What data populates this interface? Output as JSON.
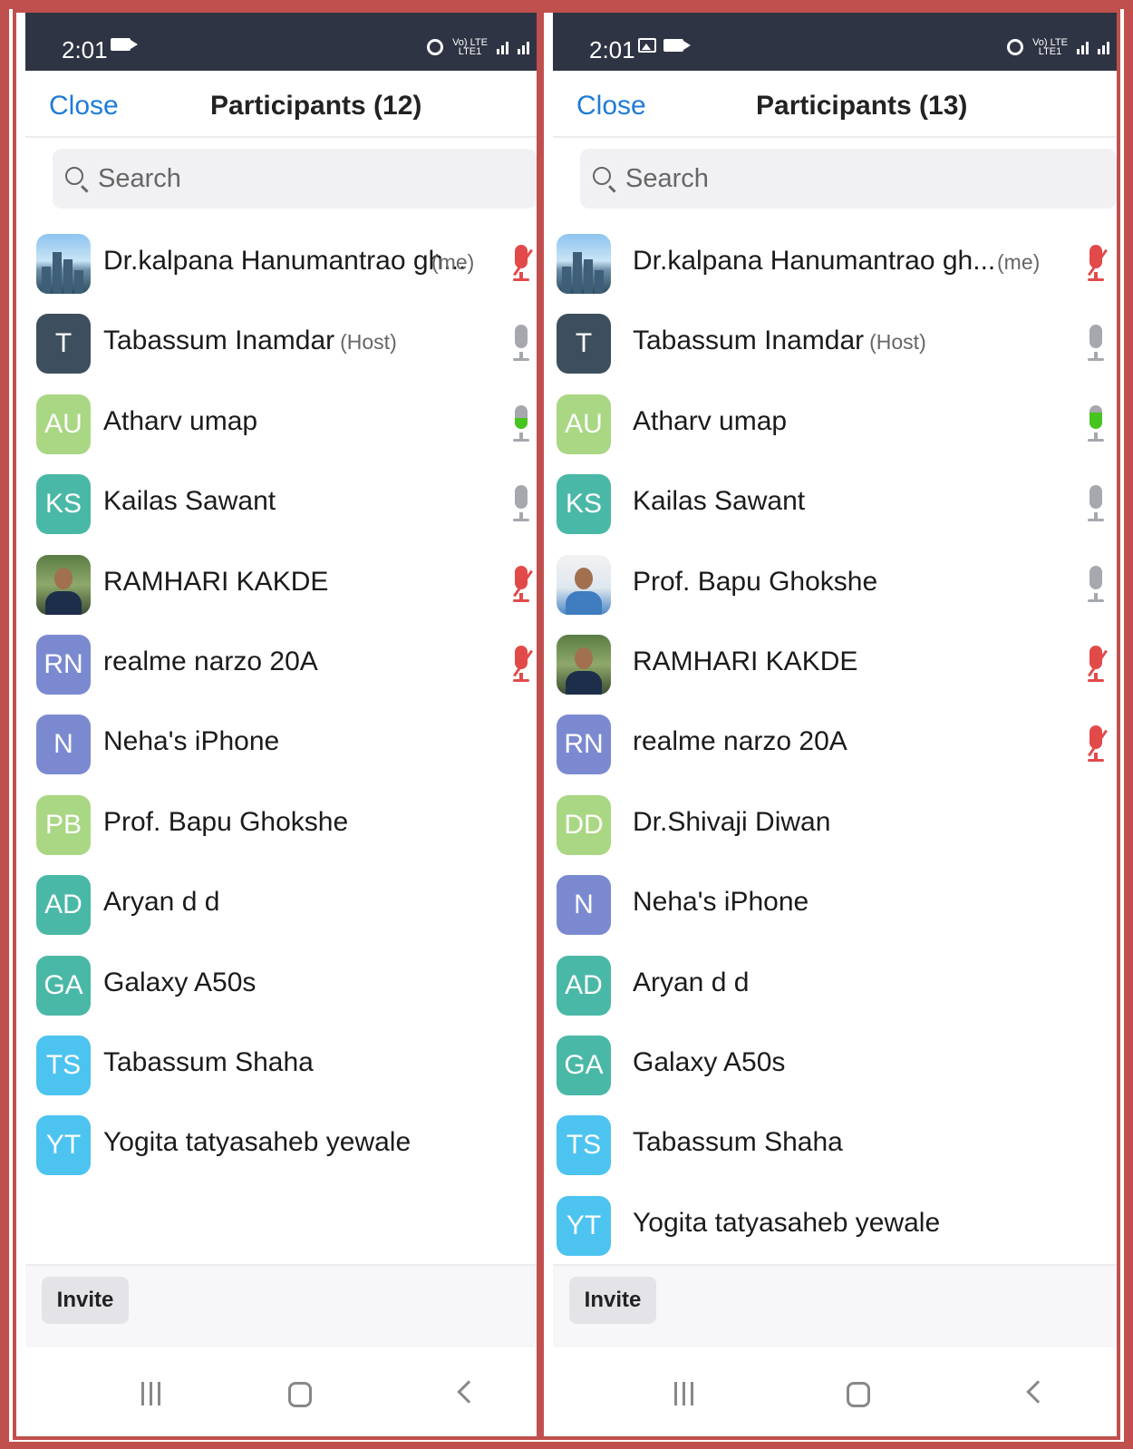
{
  "status_bar": {
    "time": "2:01",
    "network": "Vo) LTE\nLTE1"
  },
  "icons": {
    "video": "video-camera-icon",
    "gallery": "image-icon",
    "alarm": "alarm-clock-icon",
    "signal": "signal-bars-icon",
    "search": "search-icon",
    "mic": "microphone-icon",
    "mic_muted": "microphone-muted-icon",
    "recent_apps": "recent-apps-icon",
    "home": "home-icon",
    "back": "back-chevron-icon"
  },
  "colors": {
    "accent": "#1f7bd8",
    "status_bar": "#2f3444",
    "muted": "#e24a4a",
    "speaking": "#46c51f",
    "frame": "#c0504d"
  },
  "left": {
    "close_label": "Close",
    "title": "Participants (12)",
    "search_placeholder": "Search",
    "invite_label": "Invite",
    "participants": [
      {
        "initials": "",
        "name": "Dr.kalpana Hanumantrao gh...",
        "role": "",
        "me": "(me)",
        "mic": "muted",
        "color": ""
      },
      {
        "initials": "T",
        "name": "Tabassum Inamdar",
        "role": "(Host)",
        "me": "",
        "mic": "on",
        "color": "#3d4f5e"
      },
      {
        "initials": "AU",
        "name": "Atharv umap",
        "role": "",
        "me": "",
        "mic": "speaking-low",
        "color": "#a9d783"
      },
      {
        "initials": "KS",
        "name": "Kailas Sawant",
        "role": "",
        "me": "",
        "mic": "on",
        "color": "#4ab8a6"
      },
      {
        "initials": "",
        "name": "RAMHARI KAKDE",
        "role": "",
        "me": "",
        "mic": "muted",
        "color": ""
      },
      {
        "initials": "RN",
        "name": "realme narzo 20A",
        "role": "",
        "me": "",
        "mic": "muted",
        "color": "#7b8ad0"
      },
      {
        "initials": "N",
        "name": "Neha's iPhone",
        "role": "",
        "me": "",
        "mic": "none",
        "color": "#7b8ad0"
      },
      {
        "initials": "PB",
        "name": "Prof. Bapu Ghokshe",
        "role": "",
        "me": "",
        "mic": "none",
        "color": "#a9d783"
      },
      {
        "initials": "AD",
        "name": "Aryan d d",
        "role": "",
        "me": "",
        "mic": "none",
        "color": "#4ab8a6"
      },
      {
        "initials": "GA",
        "name": "Galaxy A50s",
        "role": "",
        "me": "",
        "mic": "none",
        "color": "#4ab8a6"
      },
      {
        "initials": "TS",
        "name": "Tabassum Shaha",
        "role": "",
        "me": "",
        "mic": "none",
        "color": "#4dc3f0"
      },
      {
        "initials": "YT",
        "name": "Yogita tatyasaheb yewale",
        "role": "",
        "me": "",
        "mic": "none",
        "color": "#4dc3f0"
      }
    ]
  },
  "right": {
    "close_label": "Close",
    "title": "Participants (13)",
    "search_placeholder": "Search",
    "invite_label": "Invite",
    "participants": [
      {
        "initials": "",
        "name": "Dr.kalpana Hanumantrao gh...",
        "role": "",
        "me": "(me)",
        "mic": "muted",
        "color": ""
      },
      {
        "initials": "T",
        "name": "Tabassum Inamdar",
        "role": "(Host)",
        "me": "",
        "mic": "on",
        "color": "#3d4f5e"
      },
      {
        "initials": "AU",
        "name": "Atharv umap",
        "role": "",
        "me": "",
        "mic": "speaking-high",
        "color": "#a9d783"
      },
      {
        "initials": "KS",
        "name": "Kailas Sawant",
        "role": "",
        "me": "",
        "mic": "on",
        "color": "#4ab8a6"
      },
      {
        "initials": "",
        "name": "Prof. Bapu Ghokshe",
        "role": "",
        "me": "",
        "mic": "on",
        "color": ""
      },
      {
        "initials": "",
        "name": "RAMHARI KAKDE",
        "role": "",
        "me": "",
        "mic": "muted",
        "color": ""
      },
      {
        "initials": "RN",
        "name": "realme narzo 20A",
        "role": "",
        "me": "",
        "mic": "muted",
        "color": "#7b8ad0"
      },
      {
        "initials": "DD",
        "name": "Dr.Shivaji Diwan",
        "role": "",
        "me": "",
        "mic": "none",
        "color": "#a9d783"
      },
      {
        "initials": "N",
        "name": "Neha's iPhone",
        "role": "",
        "me": "",
        "mic": "none",
        "color": "#7b8ad0"
      },
      {
        "initials": "AD",
        "name": "Aryan d d",
        "role": "",
        "me": "",
        "mic": "none",
        "color": "#4ab8a6"
      },
      {
        "initials": "GA",
        "name": "Galaxy A50s",
        "role": "",
        "me": "",
        "mic": "none",
        "color": "#4ab8a6"
      },
      {
        "initials": "TS",
        "name": "Tabassum Shaha",
        "role": "",
        "me": "",
        "mic": "none",
        "color": "#4dc3f0"
      },
      {
        "initials": "YT",
        "name": "Yogita tatyasaheb yewale",
        "role": "",
        "me": "",
        "mic": "none",
        "color": "#4dc3f0"
      }
    ]
  }
}
